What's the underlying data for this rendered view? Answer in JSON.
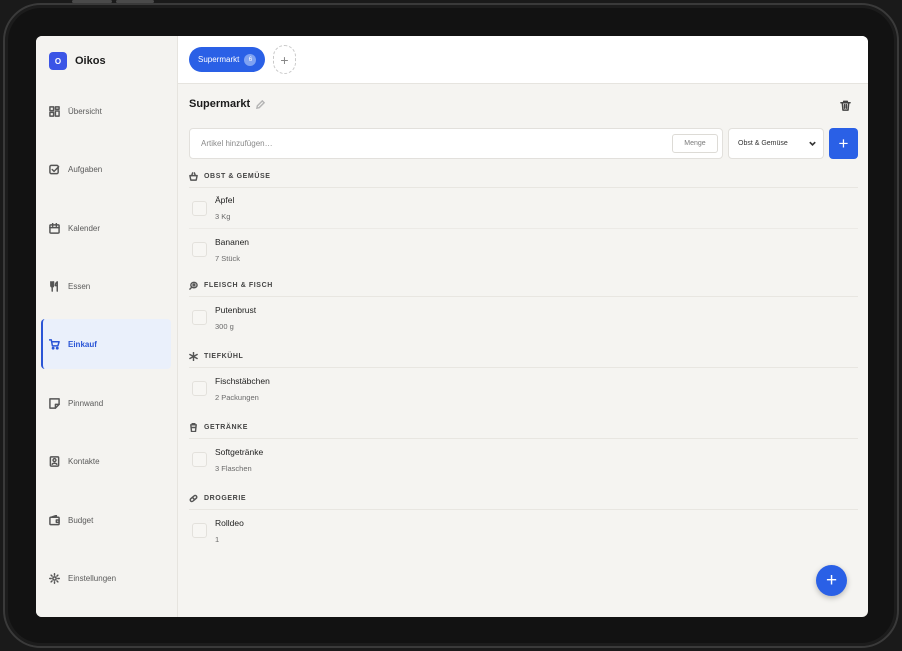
{
  "app": {
    "name": "Oikos",
    "logo_letter": "O"
  },
  "sidebar": {
    "items": [
      {
        "label": "Übersicht",
        "icon": "dashboard-icon"
      },
      {
        "label": "Aufgaben",
        "icon": "checkbox-icon"
      },
      {
        "label": "Kalender",
        "icon": "calendar-icon"
      },
      {
        "label": "Essen",
        "icon": "fork-knife-icon"
      },
      {
        "label": "Einkauf",
        "icon": "cart-icon",
        "active": true
      },
      {
        "label": "Pinnwand",
        "icon": "note-icon"
      },
      {
        "label": "Kontakte",
        "icon": "contacts-icon"
      },
      {
        "label": "Budget",
        "icon": "wallet-icon"
      },
      {
        "label": "Einstellungen",
        "icon": "gear-icon"
      }
    ]
  },
  "tabs": {
    "active_label": "Supermarkt",
    "active_count": "6",
    "add_label": "+"
  },
  "list": {
    "title": "Supermarkt"
  },
  "add_form": {
    "item_placeholder": "Artikel hinzufügen…",
    "qty_placeholder": "Menge",
    "category_value": "Obst & Gemüse",
    "add_label": "+"
  },
  "sections": [
    {
      "title": "OBST & GEMÜSE",
      "icon": "basket-icon",
      "items": [
        {
          "name": "Äpfel",
          "qty": "3 Kg"
        },
        {
          "name": "Bananen",
          "qty": "7 Stück"
        }
      ]
    },
    {
      "title": "FLEISCH & FISCH",
      "icon": "meat-icon",
      "items": [
        {
          "name": "Putenbrust",
          "qty": "300 g"
        }
      ]
    },
    {
      "title": "TIEFKÜHL",
      "icon": "snowflake-icon",
      "items": [
        {
          "name": "Fischstäbchen",
          "qty": "2 Packungen"
        }
      ]
    },
    {
      "title": "GETRÄNKE",
      "icon": "bottle-icon",
      "items": [
        {
          "name": "Softgetränke",
          "qty": "3 Flaschen"
        }
      ]
    },
    {
      "title": "DROGERIE",
      "icon": "pill-icon",
      "items": [
        {
          "name": "Rolldeo",
          "qty": "1"
        }
      ]
    }
  ],
  "fab": {
    "label": "+"
  },
  "colors": {
    "accent": "#2a60e6",
    "brand": "#3b55e6"
  }
}
